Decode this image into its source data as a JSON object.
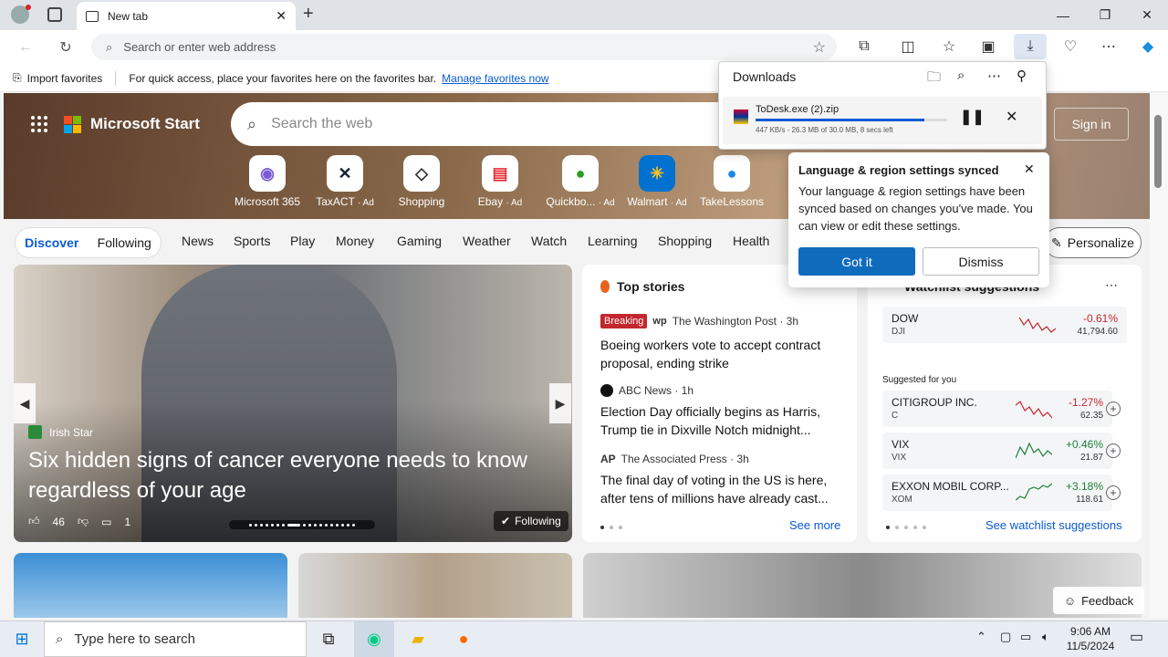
{
  "browser": {
    "tab_title": "New tab",
    "address_placeholder": "Search or enter web address",
    "favorites_bar": {
      "import_label": "Import favorites",
      "hint_text": "For quick access, place your favorites here on the favorites bar.",
      "manage_link": "Manage favorites now"
    }
  },
  "downloads": {
    "title": "Downloads",
    "item": {
      "filename": "ToDesk.exe (2).zip",
      "status": "447 KB/s - 26.3 MB of 30.0 MB, 8 secs left",
      "progress": 0.88
    }
  },
  "popup": {
    "title": "Language & region settings synced",
    "body": "Your language & region settings have been synced based on changes you've made. You can view or edit these settings.",
    "primary": "Got it",
    "secondary": "Dismiss"
  },
  "page": {
    "brand": "Microsoft Start",
    "search_placeholder": "Search the web",
    "sign_in": "Sign in",
    "quick_links": [
      {
        "label": "Microsoft 365",
        "ad": ""
      },
      {
        "label": "TaxACT",
        "ad": "· Ad"
      },
      {
        "label": "Shopping",
        "ad": ""
      },
      {
        "label": "Ebay",
        "ad": "· Ad"
      },
      {
        "label": "Quickbo...",
        "ad": "· Ad"
      },
      {
        "label": "Walmart",
        "ad": "· Ad"
      },
      {
        "label": "TakeLessons",
        "ad": ""
      }
    ],
    "pill_tabs": [
      "Discover",
      "Following"
    ],
    "nav_links": [
      "News",
      "Sports",
      "Play",
      "Money",
      "Gaming",
      "Weather",
      "Watch",
      "Learning",
      "Shopping",
      "Health"
    ],
    "personalize": "Personalize",
    "hero_card": {
      "source": "Irish Star",
      "headline": "Six hidden signs of cancer everyone needs to know regardless of your age",
      "likes": "46",
      "comments": "1",
      "following": "Following"
    },
    "top_stories": {
      "title": "Top stories",
      "items": [
        {
          "badge": "Breaking",
          "source": "The Washington Post · 3h",
          "headline": "Boeing workers vote to accept contract proposal, ending strike"
        },
        {
          "badge": "",
          "source": "ABC News · 1h",
          "headline": "Election Day officially begins as Harris, Trump tie in Dixville Notch midnight..."
        },
        {
          "badge": "",
          "source": "The Associated Press · 3h",
          "headline": "The final day of voting in the US is here, after tens of millions have already cast..."
        }
      ],
      "see_more": "See more"
    },
    "watchlist": {
      "title": "Watchlist suggestions",
      "featured": {
        "name": "DOW",
        "symbol": "DJI",
        "change": "-0.61%",
        "price": "41,794.60"
      },
      "suggested_label": "Suggested for you",
      "suggested": [
        {
          "name": "CITIGROUP INC.",
          "symbol": "C",
          "change": "-1.27%",
          "price": "62.35",
          "color": "#c4262e"
        },
        {
          "name": "VIX",
          "symbol": "VIX",
          "change": "+0.46%",
          "price": "21.87",
          "color": "#1a7f37"
        },
        {
          "name": "EXXON MOBIL CORP...",
          "symbol": "XOM",
          "change": "+3.18%",
          "price": "118.61",
          "color": "#1a7f37"
        }
      ],
      "see_link": "See watchlist suggestions"
    },
    "feedback": "Feedback"
  },
  "taskbar": {
    "search_placeholder": "Type here to search",
    "time": "9:06 AM",
    "date": "11/5/2024"
  }
}
